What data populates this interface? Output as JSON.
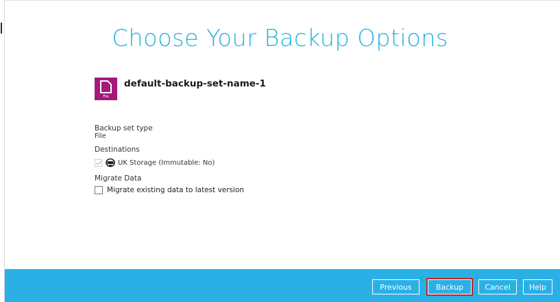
{
  "page": {
    "title": "Choose Your Backup Options"
  },
  "backup_set": {
    "icon": "file-icon",
    "icon_caption": "File",
    "icon_color": "#a31a78",
    "name": "default-backup-set-name-1"
  },
  "backup_set_type": {
    "label": "Backup set type",
    "value": "File"
  },
  "destinations": {
    "label": "Destinations",
    "items": [
      {
        "text": "UK Storage (Immutable: No)",
        "checked": true,
        "icon": "storage-destination-icon"
      }
    ]
  },
  "migrate": {
    "label": "Migrate Data",
    "option_label": "Migrate existing data to latest version",
    "checked": false
  },
  "footer": {
    "color": "#2bb0e6",
    "buttons": {
      "previous": "Previous",
      "backup": "Backup",
      "cancel": "Cancel",
      "help": "Help"
    },
    "highlighted_button": "Backup",
    "highlight_color": "#cc1f1f"
  },
  "colors": {
    "title": "#29b0e0",
    "text": "#333333"
  }
}
